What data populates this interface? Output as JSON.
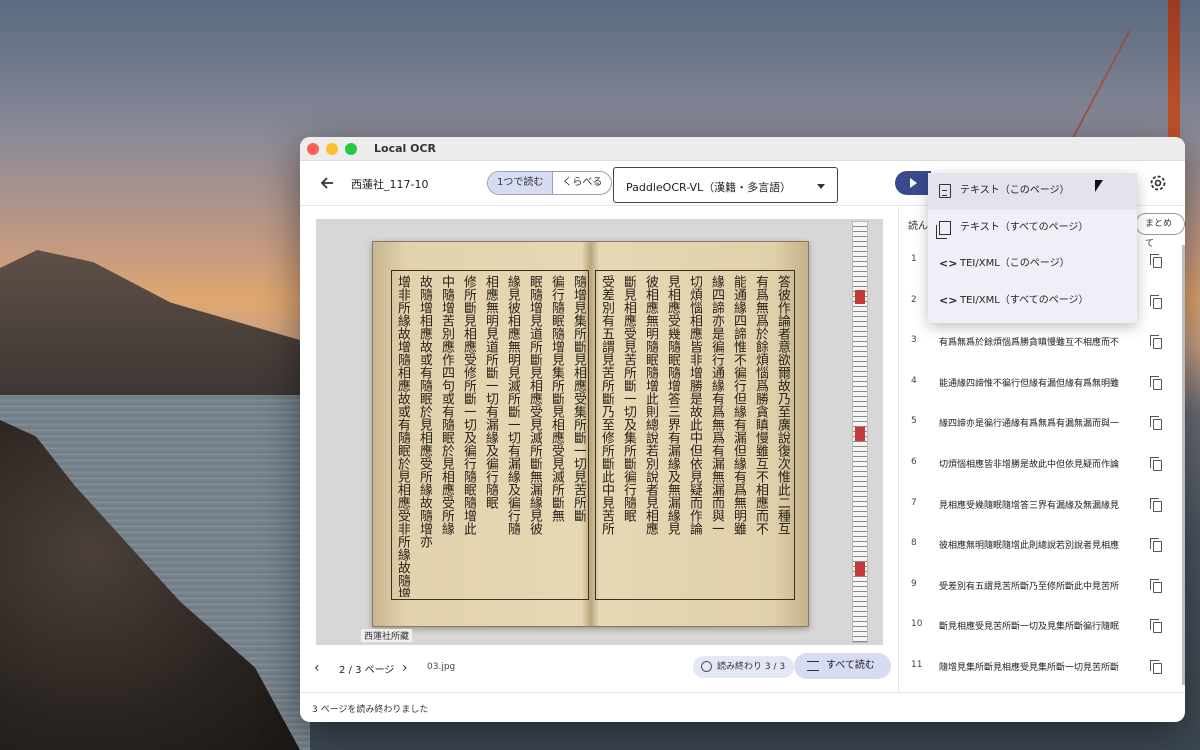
{
  "app": {
    "title": "Local OCR"
  },
  "toolbar": {
    "doc_name": "西蓮社_117-10",
    "mode_single": "1つで読む",
    "mode_compare": "くらべる",
    "model": "PaddleOCR-VL（漢籍・多言語）"
  },
  "export_menu": {
    "items": [
      {
        "icon": "document-icon",
        "label": "テキスト（このページ）"
      },
      {
        "icon": "documents-icon",
        "label": "テキスト（すべてのページ）"
      },
      {
        "icon": "code-icon",
        "label": "TEI/XML（このページ）"
      },
      {
        "icon": "code-icon",
        "label": "TEI/XML（すべてのページ）"
      }
    ]
  },
  "viewer": {
    "stamp": "西蓮社所藏",
    "page_indicator": "2 / 3 ページ",
    "filename": "03.jpg",
    "done_chip": "読み終わり 3 / 3",
    "read_all": "すべて読む",
    "left_page_columns": [
      "增非所緣故增隨相應故或有隨眠於見相應受非所緣故隨增亦非",
      "故隨增相應故或有隨眠於見相應受所緣故隨增亦",
      "中隨增苦別應作四句或有隨眠於見相應受所緣",
      "修所斷見相應受修所斷一切及徧行隨眠隨增此",
      "相應無明見道所斷一切有漏緣及徧行隨眠",
      "緣見彼相應無明見滅所斷一切有漏緣及徧行隨",
      "眠隨增見道所斷見相應受見滅所斷無漏緣見彼",
      "徧行隨眠隨增見集所斷見相應受見滅所斷無",
      "隨增見集所斷見相應受集所斷一切見苦所斷"
    ],
    "right_page_columns": [
      "受差別有五謂見苦所斷乃至修所斷此中見苦所",
      "斷見相應受見苦所斷一切及集所斷徧行隨眠",
      "彼相應無明隨眠隨增此則總說若別說者見相應",
      "見相應受幾隨眠隨增答三界有漏緣及無漏緣見",
      "切煩惱相應皆非增勝是故此中但依見疑而作論",
      "緣四諦亦是徧行通緣有爲無爲有漏無漏而與一",
      "能通緣四諦惟不徧行但緣有漏但緣有爲無明雖",
      "有爲無爲於餘煩惱爲勝貪瞋慢雖互不相應而不",
      "答彼作論者意欲爾故乃至廣說復次惟此二種互"
    ]
  },
  "results": {
    "header": "読ん",
    "merge_button": "まとめて",
    "rows": [
      {
        "n": "1",
        "text": ""
      },
      {
        "n": "2",
        "text": ""
      },
      {
        "n": "3",
        "text": "有爲無爲於餘煩惱爲勝貪瞋慢雖互不相應而不"
      },
      {
        "n": "4",
        "text": "能通緣四諦惟不徧行但緣有漏但緣有爲無明雖"
      },
      {
        "n": "5",
        "text": "緣四諦亦是徧行通緣有爲無爲有漏無漏而與一"
      },
      {
        "n": "6",
        "text": "切煩惱相應皆非增勝是故此中但依見疑而作論"
      },
      {
        "n": "7",
        "text": "見相應受幾隨眠隨增答三界有漏緣及無漏緣見"
      },
      {
        "n": "8",
        "text": "彼相應無明隨眠隨增此則總說若別說者見相應"
      },
      {
        "n": "9",
        "text": "受差別有五謂見苦所斷乃至修所斷此中見苦所"
      },
      {
        "n": "10",
        "text": "斷見相應受見苦所斷一切及見集所斷徧行隨眠"
      },
      {
        "n": "11",
        "text": "隨增見集所斷見相應受見集所斷一切見苦所斷"
      }
    ]
  },
  "status": {
    "message": "3 ページを読み終わりました"
  }
}
